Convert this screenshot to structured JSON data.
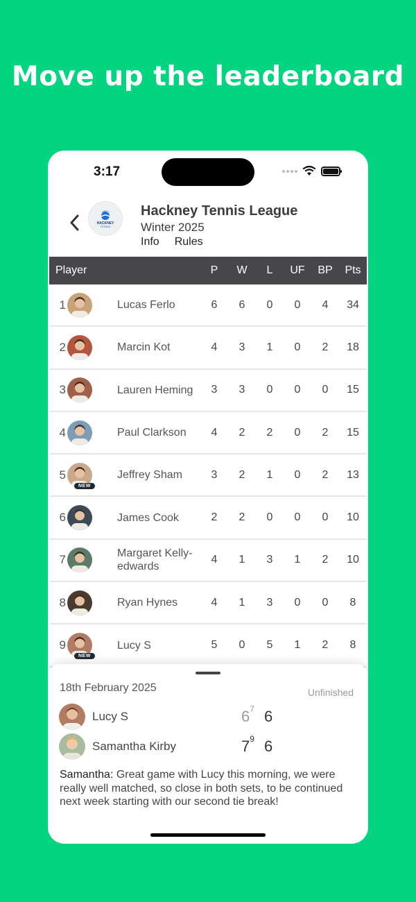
{
  "headline": "Move up the leaderboard",
  "status_bar": {
    "time": "3:17"
  },
  "league": {
    "title": "Hackney Tennis League",
    "season": "Winter 2025",
    "logo_text": "HACKNEY",
    "logo_sub": "TENNIS",
    "links": [
      "Info",
      "Rules"
    ]
  },
  "table": {
    "columns": [
      "Player",
      "P",
      "W",
      "L",
      "UF",
      "BP",
      "Pts"
    ],
    "rows": [
      {
        "rank": "1",
        "name": "Lucas Ferlo",
        "p": "6",
        "w": "6",
        "l": "0",
        "uf": "0",
        "bp": "4",
        "pts": "34",
        "new": ""
      },
      {
        "rank": "2",
        "name": "Marcin Kot",
        "p": "4",
        "w": "3",
        "l": "1",
        "uf": "0",
        "bp": "2",
        "pts": "18",
        "new": ""
      },
      {
        "rank": "3",
        "name": "Lauren Heming",
        "p": "3",
        "w": "3",
        "l": "0",
        "uf": "0",
        "bp": "0",
        "pts": "15",
        "new": ""
      },
      {
        "rank": "4",
        "name": "Paul Clarkson",
        "p": "4",
        "w": "2",
        "l": "2",
        "uf": "0",
        "bp": "2",
        "pts": "15",
        "new": ""
      },
      {
        "rank": "5",
        "name": "Jeffrey Sham",
        "p": "3",
        "w": "2",
        "l": "1",
        "uf": "0",
        "bp": "2",
        "pts": "13",
        "new": "NEW"
      },
      {
        "rank": "6",
        "name": "James Cook",
        "p": "2",
        "w": "2",
        "l": "0",
        "uf": "0",
        "bp": "0",
        "pts": "10",
        "new": ""
      },
      {
        "rank": "7",
        "name": "Margaret Kelly-edwards",
        "p": "4",
        "w": "1",
        "l": "3",
        "uf": "1",
        "bp": "2",
        "pts": "10",
        "new": ""
      },
      {
        "rank": "8",
        "name": "Ryan Hynes",
        "p": "4",
        "w": "1",
        "l": "3",
        "uf": "0",
        "bp": "0",
        "pts": "8",
        "new": ""
      },
      {
        "rank": "9",
        "name": "Lucy S",
        "p": "5",
        "w": "0",
        "l": "5",
        "uf": "1",
        "bp": "2",
        "pts": "8",
        "new": "NEW"
      }
    ]
  },
  "match": {
    "date": "18th February 2025",
    "status": "Unfinished",
    "players": [
      {
        "name": "Lucy S",
        "set1": "6",
        "set1_tb": "7",
        "set2": "6",
        "set1_won": false
      },
      {
        "name": "Samantha Kirby",
        "set1": "7",
        "set1_tb": "9",
        "set2": "6",
        "set1_won": true
      }
    ],
    "comment_author": "Samantha:",
    "comment_text": " Great game with Lucy this morning, we were really well matched, so close in both sets, to be continued next week starting with our second tie break!"
  },
  "colors": {
    "background": "#02D47F",
    "table_header": "#47464b",
    "avatar_tones": [
      "#c9a27a",
      "#b5543f",
      "#a0604a",
      "#7d9cb5",
      "#c8a98b",
      "#3e4a57",
      "#5e7a6a",
      "#4b3b2f",
      "#b27b63"
    ]
  }
}
